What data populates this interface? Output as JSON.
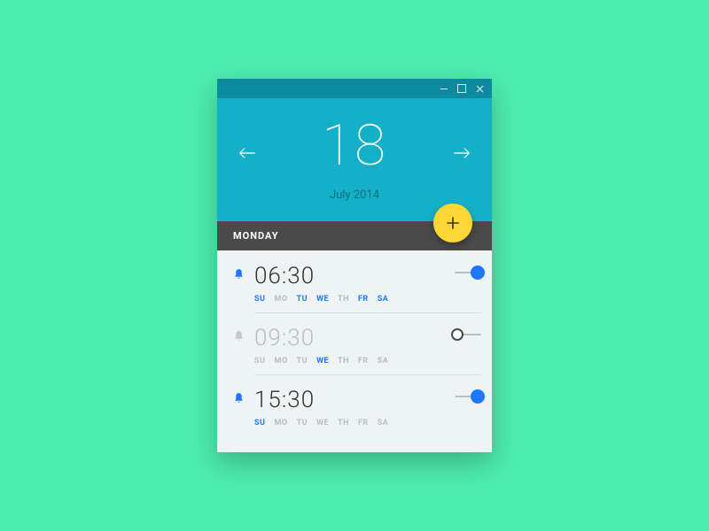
{
  "colors": {
    "accent": "#1e78ff",
    "headerBg": "#14b0c7",
    "titlebarBg": "#0d8aa0",
    "fabBg": "#ffd633",
    "dayBarBg": "#4a4a4a",
    "pageBg": "#4dedaf"
  },
  "header": {
    "dayNumber": "18",
    "monthYear": "July 2014"
  },
  "dayBar": {
    "label": "MONDAY"
  },
  "weekdays": [
    "SU",
    "MO",
    "TU",
    "WE",
    "TH",
    "FR",
    "SA"
  ],
  "alarms": [
    {
      "time": "06:30",
      "enabled": true,
      "activeDays": [
        "SU",
        "TU",
        "WE",
        "FR",
        "SA"
      ]
    },
    {
      "time": "09:30",
      "enabled": false,
      "activeDays": [
        "WE"
      ]
    },
    {
      "time": "15:30",
      "enabled": true,
      "activeDays": [
        "SU"
      ]
    }
  ]
}
